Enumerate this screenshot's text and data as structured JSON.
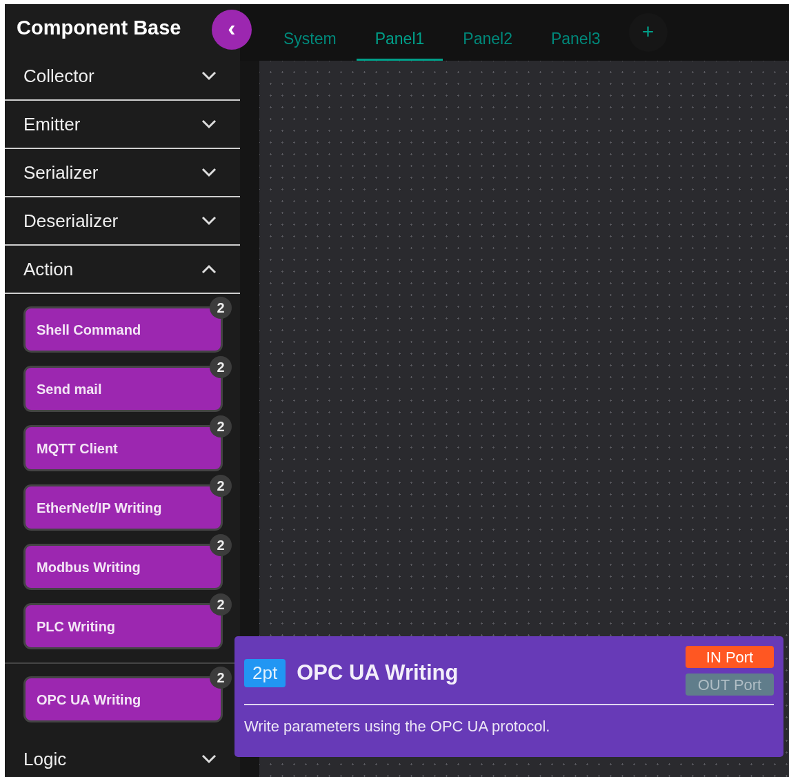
{
  "sidebar": {
    "title": "Component Base",
    "collapse_button": "‹",
    "sections": [
      {
        "label": "Collector",
        "expanded": false
      },
      {
        "label": "Emitter",
        "expanded": false
      },
      {
        "label": "Serializer",
        "expanded": false
      },
      {
        "label": "Deserializer",
        "expanded": false
      },
      {
        "label": "Action",
        "expanded": true,
        "items": [
          {
            "label": "Shell Command",
            "badge": "2",
            "hovered": false
          },
          {
            "label": "Send mail",
            "badge": "2",
            "hovered": false
          },
          {
            "label": "MQTT Client",
            "badge": "2",
            "hovered": false
          },
          {
            "label": "EtherNet/IP Writing",
            "badge": "2",
            "hovered": false
          },
          {
            "label": "Modbus Writing",
            "badge": "2",
            "hovered": false
          },
          {
            "label": "PLC Writing",
            "badge": "2",
            "hovered": false
          },
          {
            "label": "OPC UA Writing",
            "badge": "2",
            "hovered": true
          }
        ]
      },
      {
        "label": "Logic",
        "expanded": false
      }
    ]
  },
  "tabs": [
    {
      "label": "System",
      "selected": false
    },
    {
      "label": "Panel1",
      "selected": true
    },
    {
      "label": "Panel2",
      "selected": false
    },
    {
      "label": "Panel3",
      "selected": false
    }
  ],
  "add_tab_button": "+",
  "detail_popup": {
    "tag": "2pt",
    "title": "OPC UA Writing",
    "description": "Write parameters using the OPC UA protocol.",
    "ports": [
      {
        "label": "IN Port",
        "active": true
      },
      {
        "label": "OUT Port",
        "active": false
      }
    ]
  }
}
